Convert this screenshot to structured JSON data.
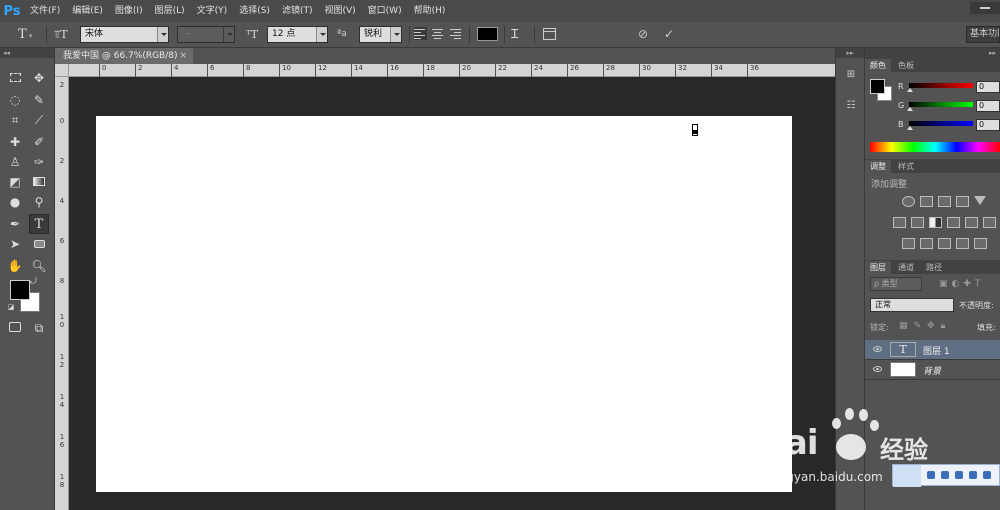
{
  "app": {
    "logo": "Ps",
    "menu": [
      "文件(F)",
      "编辑(E)",
      "图像(I)",
      "图层(L)",
      "文字(Y)",
      "选择(S)",
      "滤镜(T)",
      "视图(V)",
      "窗口(W)",
      "帮助(H)"
    ]
  },
  "options_bar": {
    "font_family": "宋体",
    "font_style": "-",
    "font_size": "12 点",
    "antialias_label": "ªa",
    "antialias": "锐利",
    "text_color": "#000000",
    "workspace": "基本功能"
  },
  "document": {
    "tab_title": "我爱中国 @ 66.7%(RGB/8)",
    "tab_close": "×",
    "ruler_top": [
      "0",
      "2",
      "4",
      "6",
      "8",
      "10",
      "12",
      "14",
      "16",
      "18",
      "20",
      "22",
      "24",
      "26",
      "28",
      "30",
      "32",
      "34",
      "36"
    ],
    "ruler_left": [
      "2",
      "0",
      "2",
      "4",
      "6",
      "8",
      "1 0",
      "1 2",
      "1 4",
      "1 6",
      "1 8"
    ],
    "canvas_color": "#ffffff"
  },
  "color_panel": {
    "tabs": [
      "颜色",
      "色板"
    ],
    "sliders": [
      {
        "label": "R",
        "value": "0"
      },
      {
        "label": "G",
        "value": "0"
      },
      {
        "label": "B",
        "value": "0"
      }
    ]
  },
  "adjustments_panel": {
    "tabs": [
      "调整",
      "样式"
    ],
    "title": "添加调整"
  },
  "layers_panel": {
    "tabs": [
      "图层",
      "通道",
      "路径"
    ],
    "filter": "ρ 类型",
    "blend_mode": "正常",
    "opacity_label": "不透明度:",
    "lock_label": "锁定:",
    "fill_label": "填充:",
    "layers": [
      {
        "name": "图层 1",
        "type": "text",
        "selected": true
      },
      {
        "name": "背景",
        "type": "background",
        "selected": false
      }
    ]
  },
  "watermark": {
    "brand": "Bai",
    "product": "经验",
    "url": "jingyan.baidu.com"
  }
}
